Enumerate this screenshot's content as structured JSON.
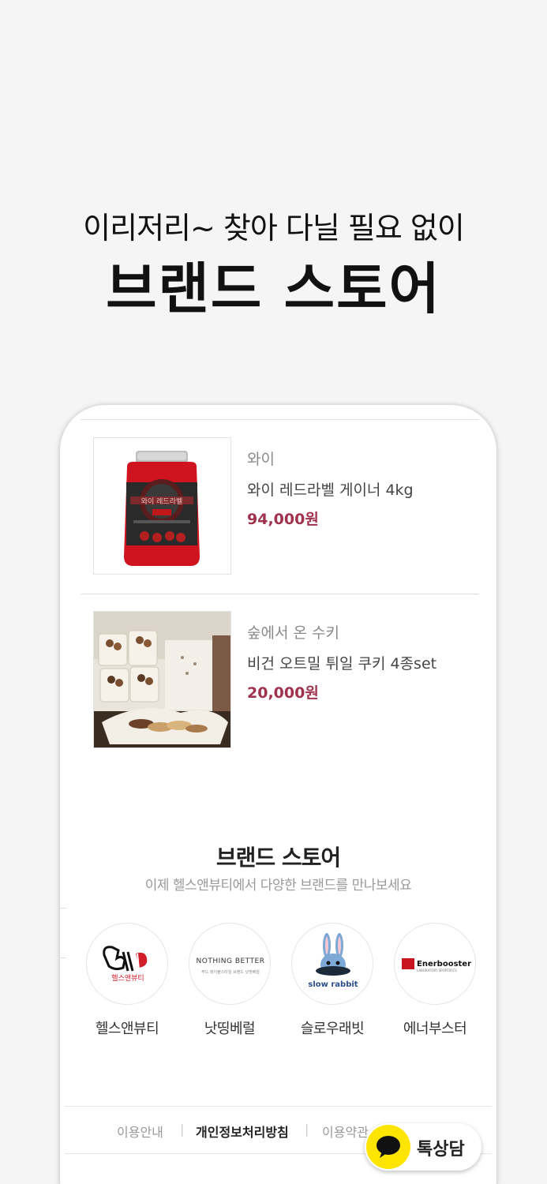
{
  "hero": {
    "subtitle": "이리저리~ 찾아 다닐 필요 없이",
    "title": "브랜드 스토어"
  },
  "products": [
    {
      "brand": "와이",
      "name": "와이 레드라벨 게이너 4kg",
      "price": "94,000원",
      "image_text": "와이 레드라벨"
    },
    {
      "brand": "숲에서 온 수키",
      "name": "비건 오트밀 튀일 쿠키 4종set",
      "price": "20,000원"
    }
  ],
  "brand_store": {
    "title": "브랜드 스토어",
    "subtitle": "이제 헬스앤뷰티에서 다양한 브랜드를 만나보세요",
    "brands": [
      {
        "label": "헬스앤뷰티",
        "logo_text": "헬스앤뷰티"
      },
      {
        "label": "낫띵베럴",
        "logo_text": "NOTHING BETTER",
        "logo_subtext": "푸드 레이블스타일 브랜드 낫띵베럴"
      },
      {
        "label": "슬로우래빗",
        "logo_text": "slow rabbit"
      },
      {
        "label": "에너부스터",
        "logo_text": "Enerbooster",
        "logo_subtext": "LABORATORY SPORTIFICS"
      }
    ]
  },
  "footer": {
    "links": [
      "이용안내",
      "개인정보처리방침",
      "이용약관"
    ]
  },
  "kakao": {
    "label": "톡상담",
    "accent": "#fee500"
  },
  "colors": {
    "price": "#a0324e",
    "background": "#f5f5f5"
  }
}
